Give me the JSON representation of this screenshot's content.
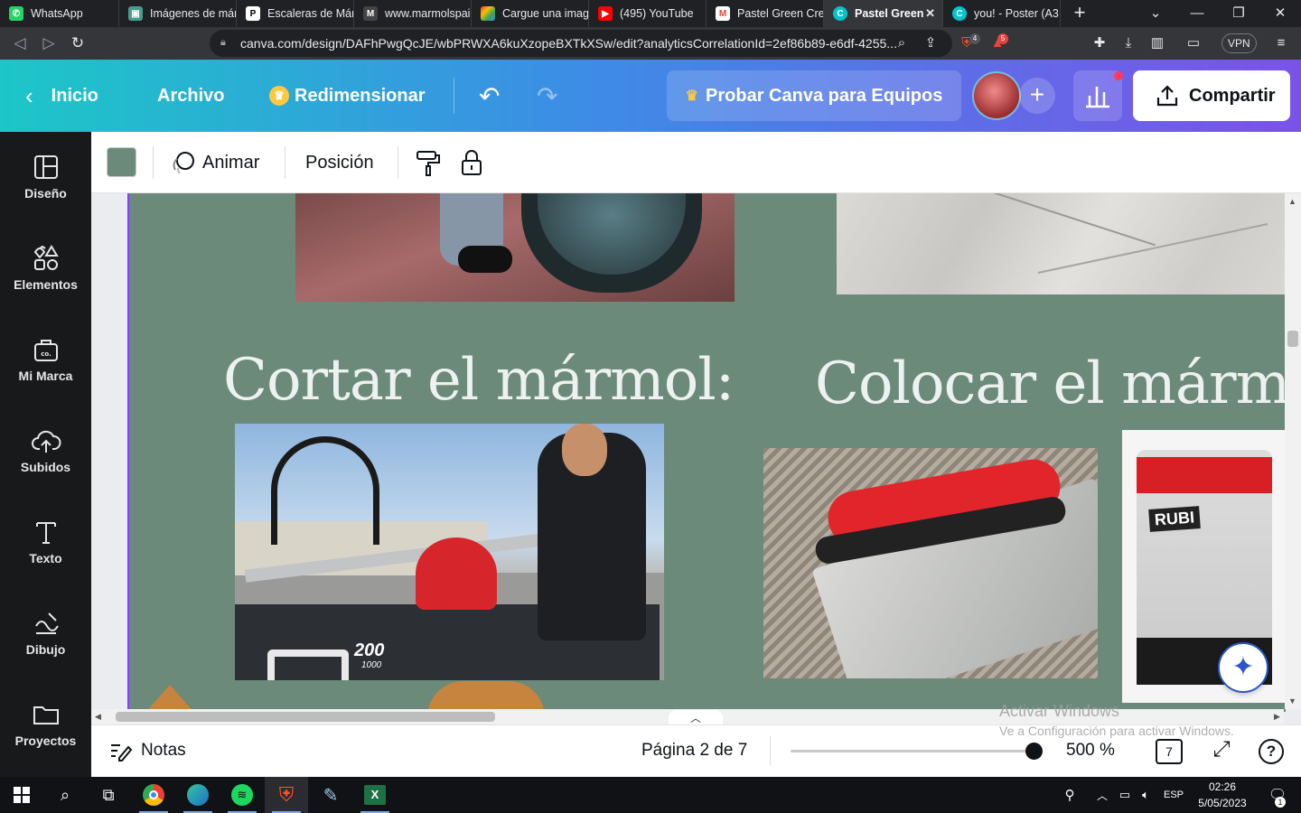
{
  "browser": {
    "tabs": [
      {
        "title": "WhatsApp",
        "icon": "whatsapp-icon",
        "color": "#25d366"
      },
      {
        "title": "Imágenes de már",
        "icon": "image-icon",
        "color": "#4a9c8c"
      },
      {
        "title": "Escaleras de Márm",
        "icon": "p-icon",
        "color": "#ffffff"
      },
      {
        "title": "www.marmolspai",
        "icon": "m-icon",
        "color": "#444444"
      },
      {
        "title": "Cargue una imag",
        "icon": "google-icon",
        "color": "#f4b400"
      },
      {
        "title": "(495) YouTube",
        "icon": "youtube-icon",
        "color": "#ff0000"
      },
      {
        "title": "Pastel Green Crea",
        "icon": "gmail-icon",
        "color": "#ea4335"
      },
      {
        "title": "Pastel Green",
        "icon": "canva-icon",
        "color": "#00c4cc"
      },
      {
        "title": "you! - Poster (A3",
        "icon": "canva-icon",
        "color": "#00c4cc"
      }
    ],
    "url": "canva.com/design/DAFhPwgQcJE/wbPRWXA6kuXzopeBXTkXSw/edit?analyticsCorrelationId=2ef86b89-e6df-4255...",
    "brave_badge": "4",
    "alert_badge": "5",
    "vpn_label": "VPN"
  },
  "header": {
    "home": "Inicio",
    "file": "Archivo",
    "resize": "Redimensionar",
    "trial": "Probar Canva para Equipos",
    "share": "Compartir"
  },
  "sidebar": {
    "items": [
      {
        "label": "Diseño",
        "icon": "layout-icon"
      },
      {
        "label": "Elementos",
        "icon": "shapes-icon"
      },
      {
        "label": "Mi Marca",
        "icon": "brand-icon"
      },
      {
        "label": "Subidos",
        "icon": "cloud-upload-icon"
      },
      {
        "label": "Texto",
        "icon": "text-icon"
      },
      {
        "label": "Dibujo",
        "icon": "draw-icon"
      },
      {
        "label": "Proyectos",
        "icon": "folder-icon"
      }
    ]
  },
  "toolbar": {
    "swatch_color": "#6b8a7a",
    "animate": "Animar",
    "position": "Posición"
  },
  "canvas": {
    "background": "#6b8a7a",
    "heading_cut": "Cortar el mármol:",
    "heading_place": "Colocar el mármol",
    "spacer_brand": "RUBI",
    "machine_label": "200",
    "machine_sub": "1000"
  },
  "footer": {
    "notes": "Notas",
    "page_indicator": "Página 2 de 7",
    "zoom": "500 %",
    "zoom_fraction": 0.97,
    "page_count": "7",
    "help": "?"
  },
  "watermark": {
    "line1": "Activar Windows",
    "line2": "Ve a Configuración para activar Windows."
  },
  "taskbar": {
    "lang": "ESP",
    "time": "02:26",
    "date": "5/05/2023",
    "notif": "1"
  }
}
